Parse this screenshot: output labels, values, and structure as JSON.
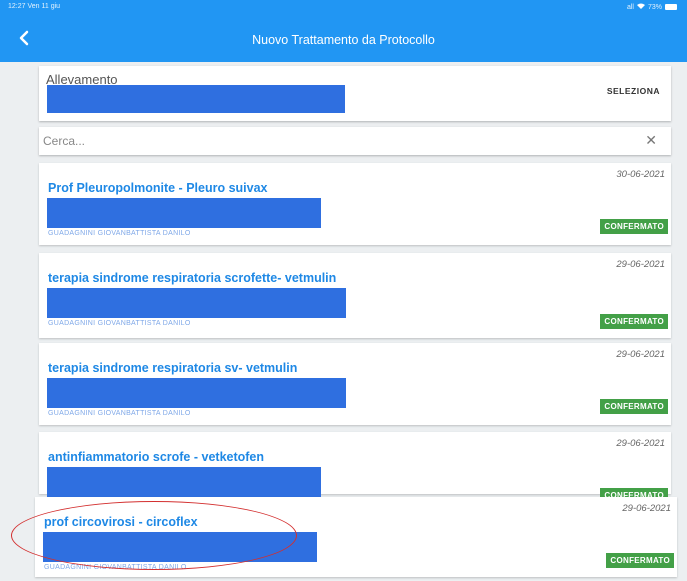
{
  "statusbar": {
    "time": "12:27",
    "date": "Ven 11 giu",
    "signal": "all",
    "battery": "73%"
  },
  "appbar": {
    "title": "Nuovo Trattamento da Protocollo",
    "back_icon": "chevron-left-icon"
  },
  "farm": {
    "label": "Allevamento",
    "select_label": "SELEZIONA"
  },
  "search": {
    "placeholder": "Cerca...",
    "clear_icon": "close-icon"
  },
  "treatments": [
    {
      "title": "Prof Pleuropolmonite - Pleuro suivax",
      "date": "30-06-2021",
      "subtitle": "GUADAGNINI GIOVANBATTISTA DANILO",
      "status": "CONFERMATO"
    },
    {
      "title": "terapia sindrome respiratoria scrofette- vetmulin",
      "date": "29-06-2021",
      "subtitle": "GUADAGNINI GIOVANBATTISTA DANILO",
      "status": "CONFERMATO"
    },
    {
      "title": "terapia sindrome respiratoria sv- vetmulin",
      "date": "29-06-2021",
      "subtitle": "GUADAGNINI GIOVANBATTISTA DANILO",
      "status": "CONFERMATO"
    },
    {
      "title": "antinfiammatorio scrofe - vetketofen",
      "date": "29-06-2021",
      "subtitle": "",
      "status": "CONFERMATO"
    },
    {
      "title": "prof circovirosi - circoflex",
      "date": "29-06-2021",
      "subtitle": "GUADAGNINI GIOVANBATTISTA DANILO",
      "status": "CONFERMATO"
    }
  ],
  "colors": {
    "primary": "#2196f3",
    "title_blue": "#1e88e5",
    "confirmed_green": "#43a047",
    "redaction_blue": "#2f6fe0",
    "annotation_red": "#d32f2f"
  }
}
